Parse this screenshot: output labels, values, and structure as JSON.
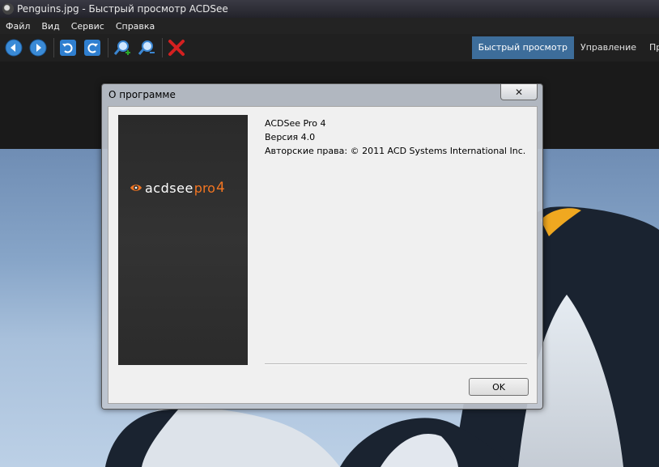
{
  "window": {
    "title": "Penguins.jpg - Быстрый просмотр ACDSee"
  },
  "menubar": {
    "items": [
      "Файл",
      "Вид",
      "Сервис",
      "Справка"
    ]
  },
  "toolbar": {
    "buttons": [
      "previous-icon",
      "next-icon",
      "rotate-left-icon",
      "rotate-right-icon",
      "zoom-in-icon",
      "zoom-out-icon",
      "delete-icon"
    ]
  },
  "mode_tabs": {
    "active": "Быстрый просмотр",
    "manage": "Управление",
    "cut": "Пр"
  },
  "dialog": {
    "title": "О программе",
    "close_label": "✕",
    "logo": {
      "brand": "acdsee",
      "pro": "pro",
      "version": "4"
    },
    "product": "ACDSee Pro 4",
    "version": "Версия 4.0",
    "copyright": "Авторские права: © 2011 ACD Systems International Inc.",
    "ok_label": "OK"
  },
  "colors": {
    "active_tab": "#3d6d9a",
    "brand_orange": "#f37521",
    "close_red": "#d42020"
  }
}
